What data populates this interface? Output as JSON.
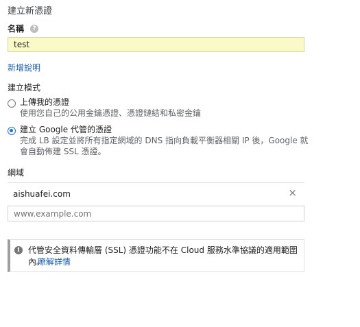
{
  "page": {
    "title": "建立新憑證"
  },
  "name_field": {
    "label": "名稱",
    "value": "test"
  },
  "add_description_link": "新增說明",
  "create_mode": {
    "heading": "建立模式",
    "options": [
      {
        "label": "上傳我的憑證",
        "description": "使用您自己的公用金鑰憑證、憑證鏈結和私密金鑰",
        "selected": false
      },
      {
        "label": "建立 Google 代管的憑證",
        "description_line1": "完成 LB 設定並將所有指定網域的 DNS 指向負載平衡器相關 IP 後，Google 就",
        "description_line2": "會自動佈建 SSL 憑證。",
        "selected": true
      }
    ]
  },
  "domains": {
    "heading": "網域",
    "entries": [
      "aishuafei.com"
    ],
    "placeholder": "www.example.com"
  },
  "notice": {
    "text_line1": "代管安全資料傳輸層 (SSL) 憑證功能不在 Cloud 服務水準協議的適用範圍",
    "text_line2": "內。",
    "link": "瞭解詳情"
  },
  "colors": {
    "accent": "#1a73e8",
    "link": "#1a5fb4",
    "input_highlight": "#fafac8"
  }
}
